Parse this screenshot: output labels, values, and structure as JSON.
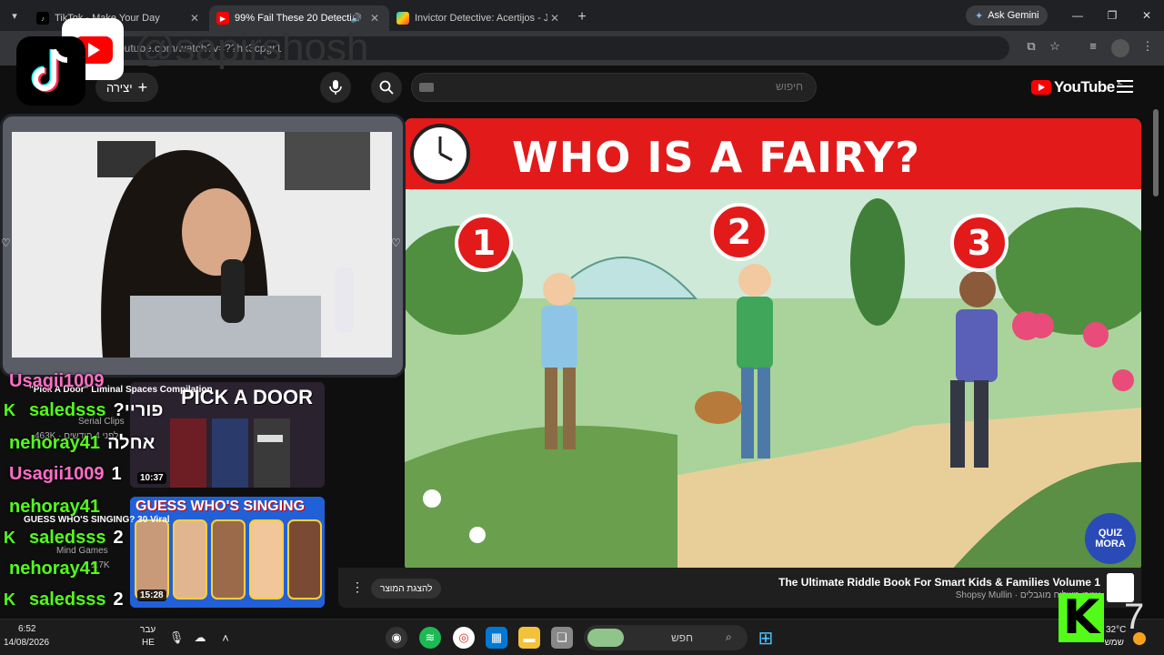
{
  "browser": {
    "tabs": [
      {
        "title": "TikTok - Make Your Day",
        "favicon": "tiktok-icon"
      },
      {
        "title": "99% Fail These 20 Detecti",
        "favicon": "youtube-icon",
        "audio": true
      },
      {
        "title": "Invictor Detective: Acertijos - J",
        "favicon": "google-play-icon"
      }
    ],
    "gemini_label": "Ask Gemini",
    "url": "youtube.com/watch?v=??hk3cpgr1"
  },
  "youtube": {
    "logo_text": "YouTube",
    "region": "IL",
    "search_placeholder": "חיפוש",
    "create_label": "יצירה"
  },
  "video": {
    "banner_title": "WHO IS A FAIRY?",
    "badges": [
      "1",
      "2",
      "3"
    ],
    "watermark": "QUIZ MORA",
    "product_title": "The Ultimate Riddle Book For Smart Kids & Families Volume 1",
    "product_sub": "Shopsy Mullin · אזורי משלוח מוגבלים",
    "product_button": "להצגת המוצר"
  },
  "recommendations": [
    {
      "thumb_title": "PICK A DOOR",
      "duration": "10:37",
      "title": "\"Pick A Door\" Liminal Spaces Compilation",
      "channel": "Serial Clips",
      "views": "463K · לפני 4 חודשים"
    },
    {
      "thumb_title": "GUESS WHO'S SINGING",
      "duration": "15:28",
      "title": "GUESS WHO'S SINGING? 30 Viral",
      "channel": "Mind Games",
      "views": "1.7K"
    }
  ],
  "overlay": {
    "handle": "@sapirshosh"
  },
  "chat": [
    {
      "name": "Usagii1009",
      "color": "#ff6ec7",
      "msg": "",
      "kick": false
    },
    {
      "name": "saledsss",
      "color": "#53fc18",
      "msg": "?פוריי",
      "kick": true
    },
    {
      "name": "nehoray41",
      "color": "#53fc18",
      "msg": "אחלה",
      "kick": false
    },
    {
      "name": "Usagii1009",
      "color": "#ff6ec7",
      "msg": "1",
      "kick": false
    },
    {
      "name": "nehoray41",
      "color": "#53fc18",
      "msg": "",
      "kick": false
    },
    {
      "name": "saledsss",
      "color": "#53fc18",
      "msg": "2",
      "kick": true
    },
    {
      "name": "nehoray41",
      "color": "#53fc18",
      "msg": "",
      "kick": false
    },
    {
      "name": "saledsss",
      "color": "#53fc18",
      "msg": "2",
      "kick": true
    },
    {
      "name": "saledsss",
      "color": "#53fc18",
      "msg": "2",
      "kick": true
    }
  ],
  "taskbar": {
    "time": "6:52",
    "date": "14/08/2026",
    "lang_top": "עבר",
    "lang_bottom": "HE",
    "search_label": "חפש",
    "temp": "32°C",
    "weather": "שמשי",
    "notif_count": "7"
  }
}
